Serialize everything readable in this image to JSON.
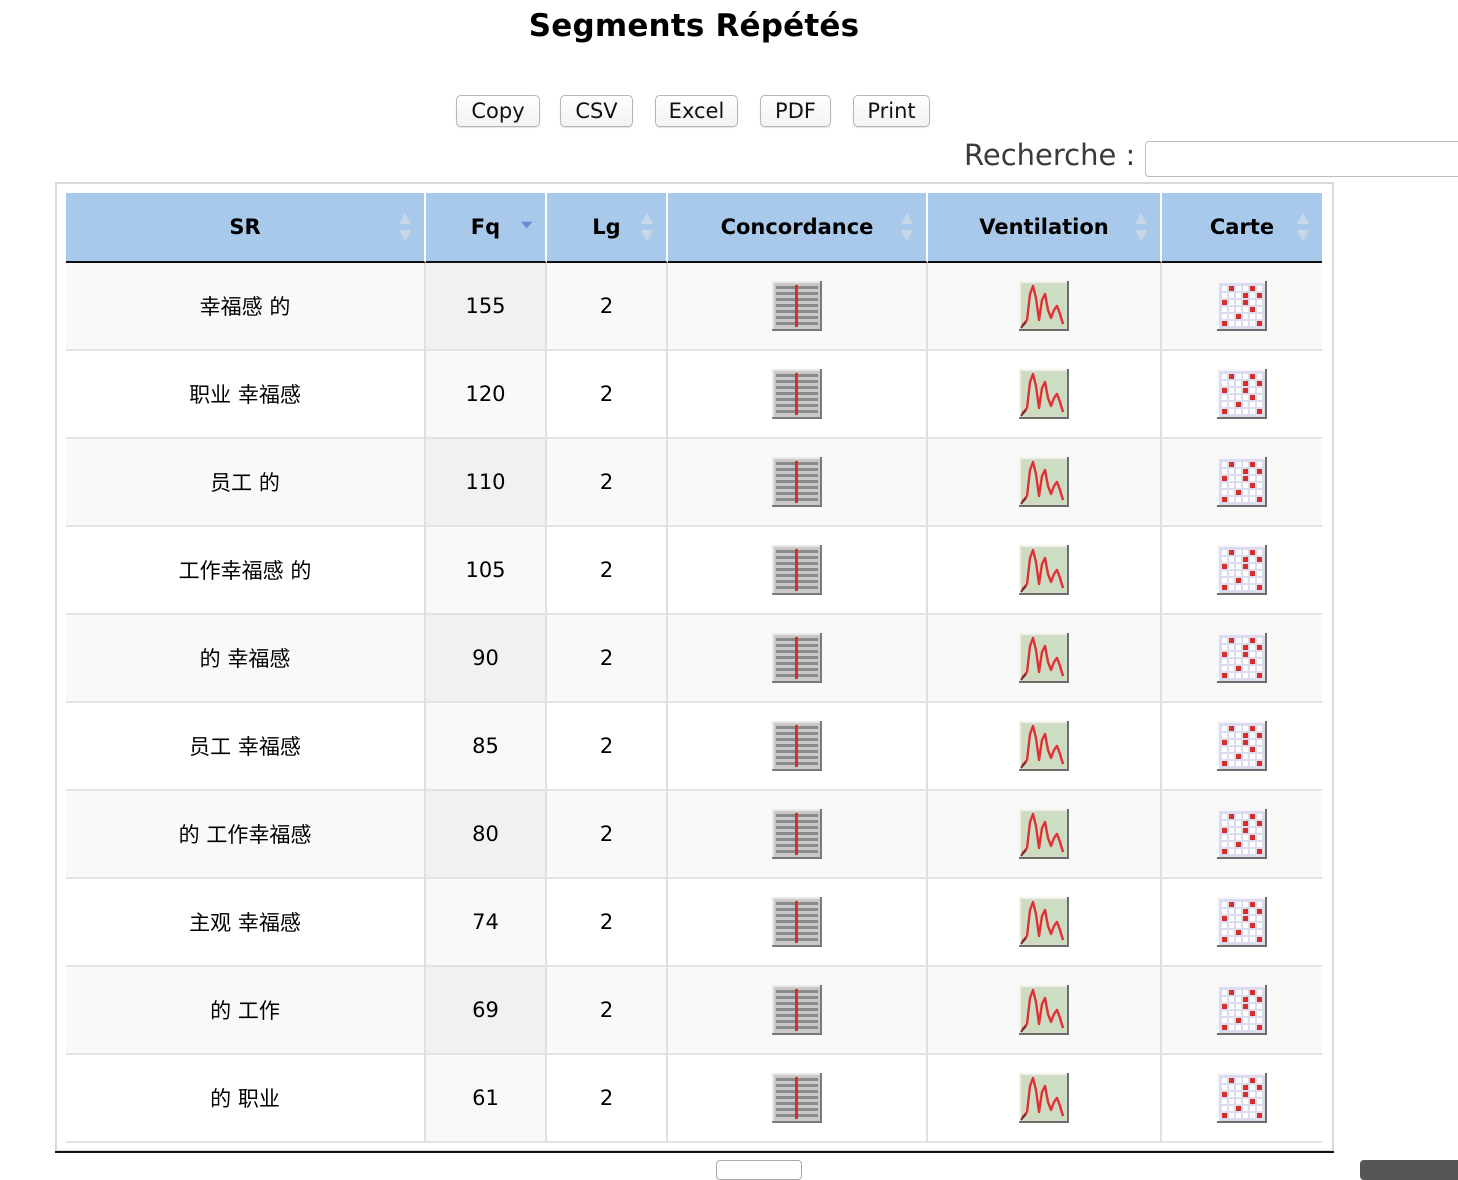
{
  "page": {
    "title": "Segments Répétés"
  },
  "toolbar": {
    "buttons": [
      {
        "label": "Copy"
      },
      {
        "label": "CSV"
      },
      {
        "label": "Excel"
      },
      {
        "label": "PDF"
      },
      {
        "label": "Print"
      }
    ]
  },
  "search": {
    "label": "Recherche :",
    "value": ""
  },
  "table": {
    "sorted_column": "Fq",
    "sort_direction": "descending",
    "header_color": "#a9c9ea",
    "columns": [
      {
        "label": "SR"
      },
      {
        "label": "Fq"
      },
      {
        "label": "Lg"
      },
      {
        "label": "Concordance"
      },
      {
        "label": "Ventilation"
      },
      {
        "label": "Carte"
      }
    ],
    "rows": [
      {
        "sr": "幸福感 的",
        "fq": "155",
        "lg": "2"
      },
      {
        "sr": "职业 幸福感",
        "fq": "120",
        "lg": "2"
      },
      {
        "sr": "员工 的",
        "fq": "110",
        "lg": "2"
      },
      {
        "sr": "工作幸福感 的",
        "fq": "105",
        "lg": "2"
      },
      {
        "sr": "的 幸福感",
        "fq": "90",
        "lg": "2"
      },
      {
        "sr": "员工 幸福感",
        "fq": "85",
        "lg": "2"
      },
      {
        "sr": "的 工作幸福感",
        "fq": "80",
        "lg": "2"
      },
      {
        "sr": "主观 幸福感",
        "fq": "74",
        "lg": "2"
      },
      {
        "sr": "的 工作",
        "fq": "69",
        "lg": "2"
      },
      {
        "sr": "的 职业",
        "fq": "61",
        "lg": "2"
      }
    ],
    "row_icons": {
      "concordance": "concordance-list-icon",
      "ventilation": "distribution-curve-icon",
      "carte": "map-grid-icon"
    }
  }
}
